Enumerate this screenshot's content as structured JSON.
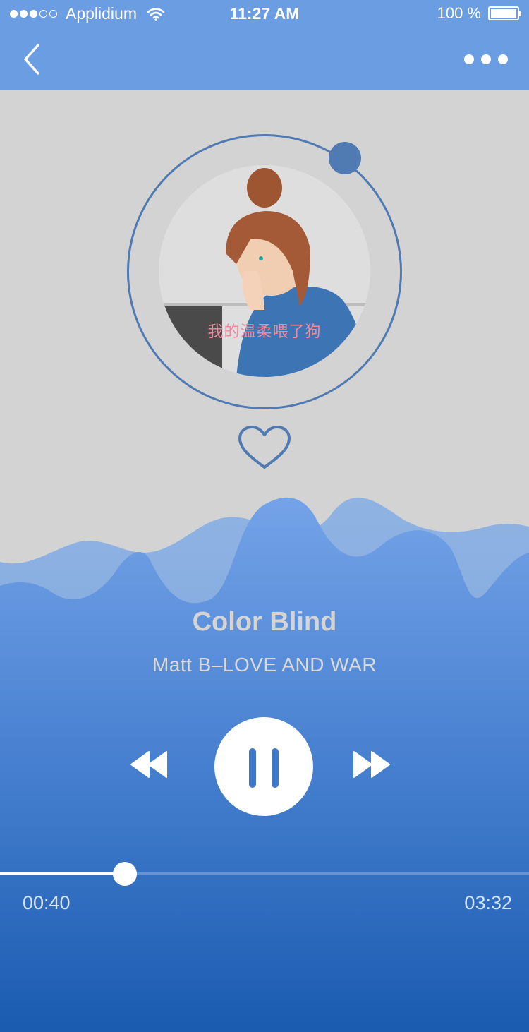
{
  "status_bar": {
    "signal_dots": [
      true,
      true,
      true,
      false,
      false
    ],
    "carrier": "Applidium",
    "time": "11:27 AM",
    "battery_text": "100 %",
    "battery_level": 1.0,
    "icons": {
      "wifi": "wifi-icon",
      "battery": "battery-icon"
    }
  },
  "nav": {
    "back_icon": "chevron-left-icon",
    "more_icon": "more-dots-icon"
  },
  "album": {
    "caption": "我的温柔喂了狗",
    "ring_color": "#4f7ab2"
  },
  "like_icon": "heart-icon",
  "song": {
    "title": "Color Blind",
    "artist": "Matt B–LOVE AND WAR"
  },
  "controls": {
    "prev_icon": "rewind-icon",
    "play_state_icon": "pause-icon",
    "next_icon": "fast-forward-icon"
  },
  "playback": {
    "current_time": "00:40",
    "total_time": "03:32",
    "progress": 0.236
  },
  "colors": {
    "header": "#6b9de3",
    "background": "#d3d3d3",
    "accent": "#4f7ab2",
    "wave_top": "#72a1e6",
    "wave_bottom": "#1a5bb0"
  }
}
